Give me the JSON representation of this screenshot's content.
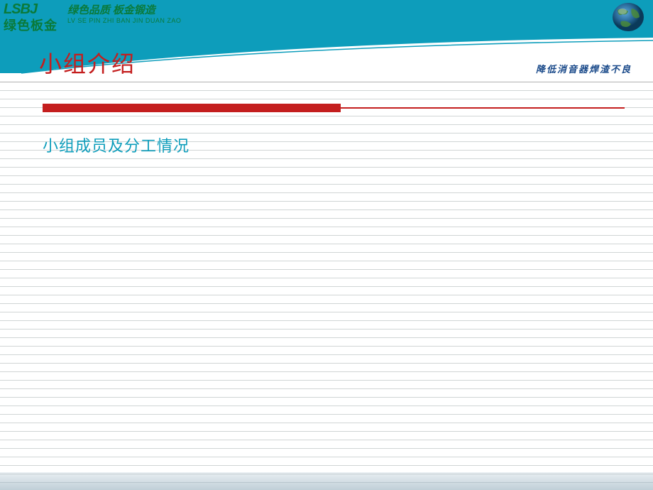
{
  "header": {
    "logo_letters": "LSBJ",
    "logo_chinese": "绿色板金",
    "logo_slogan": "绿色品质 板金锻造",
    "logo_pinyin": "LV SE PIN ZHI BAN JIN DUAN ZAO"
  },
  "title": {
    "main": "小组介绍",
    "subtitle": "降低消音器焊渣不良"
  },
  "content": {
    "section_heading": "小组成员及分工情况"
  },
  "colors": {
    "top_bar": "#0d9dbb",
    "accent_red": "#c41e1e",
    "logo_green": "#0a7a3a",
    "subtitle_blue": "#1a4a8a"
  }
}
